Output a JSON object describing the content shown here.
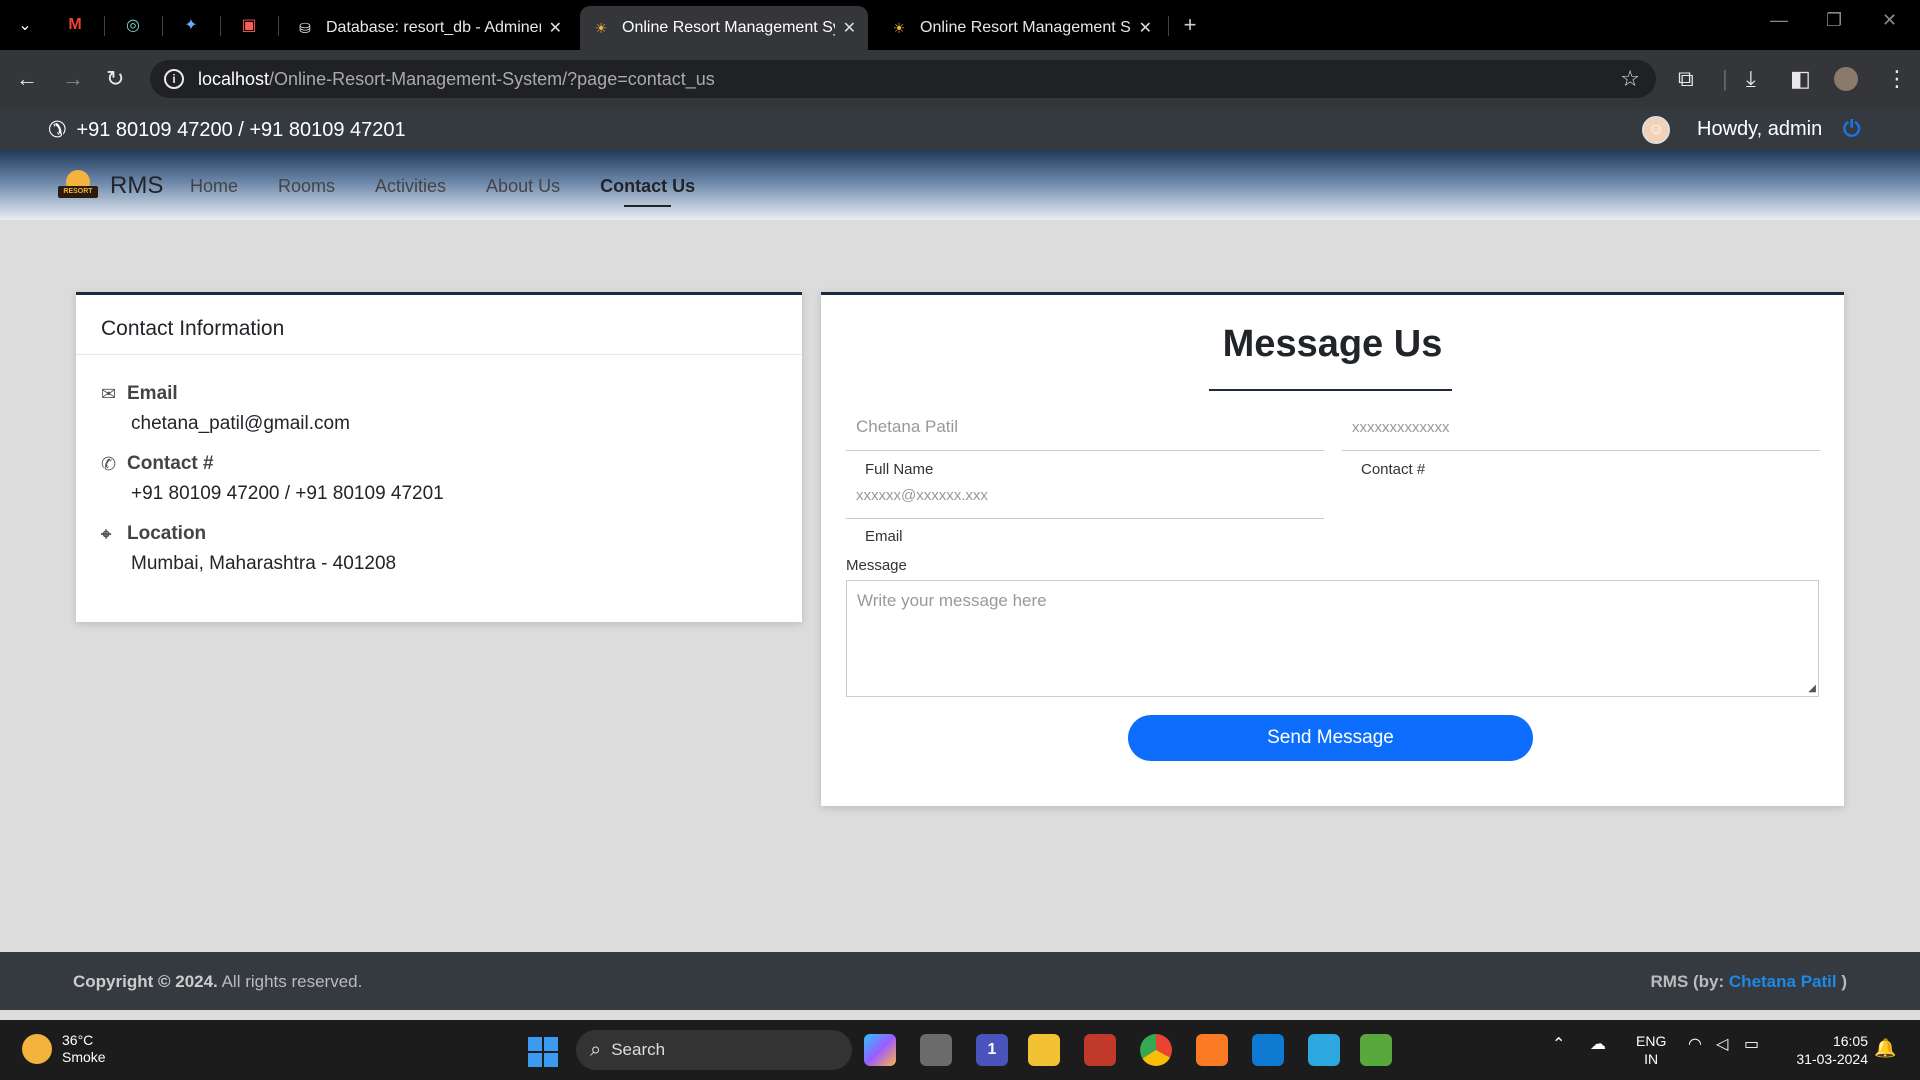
{
  "browser": {
    "tabs": [
      {
        "title": "Database: resort_db - Adminer",
        "active": false
      },
      {
        "title": "Online Resort Management Sys",
        "active": true
      },
      {
        "title": "Online Resort Management Sys",
        "active": false
      }
    ],
    "url_host": "localhost",
    "url_path": "/Online-Resort-Management-System/?page=contact_us"
  },
  "topbar": {
    "phone": "+91 80109 47200 / +91 80109 47201",
    "greeting": "Howdy, admin"
  },
  "nav": {
    "brand": "RMS",
    "logo_text": "RESORT",
    "links": [
      "Home",
      "Rooms",
      "Activities",
      "About Us",
      "Contact Us"
    ],
    "active": "Contact Us"
  },
  "contact": {
    "header": "Contact Information",
    "email_label": "Email",
    "email_value": "chetana_patil@gmail.com",
    "contact_label": "Contact #",
    "contact_value": "+91 80109 47200 / +91 80109 47201",
    "location_label": "Location",
    "location_value": "Mumbai, Maharashtra - 401208"
  },
  "message": {
    "title": "Message Us",
    "fullname_placeholder": "Chetana Patil",
    "fullname_label": "Full Name",
    "contact_placeholder": "xxxxxxxxxxxxx",
    "contact_label": "Contact #",
    "email_placeholder": "xxxxxx@xxxxxx.xxx",
    "email_label": "Email",
    "message_label": "Message",
    "message_placeholder": "Write your message here",
    "send_label": "Send Message"
  },
  "footer": {
    "copyright_bold": "Copyright © 2024.",
    "copyright_rest": " All rights reserved.",
    "credit_prefix": "RMS (by: ",
    "credit_author": "Chetana Patil",
    "credit_suffix": " )"
  },
  "taskbar": {
    "temperature": "36°C",
    "weather": "Smoke",
    "search": "Search",
    "lang1": "ENG",
    "lang2": "IN",
    "time": "16:05",
    "date": "31-03-2024",
    "teams_badge": "1"
  },
  "colors": {
    "accent": "#0d6efd",
    "dark": "#343a40",
    "card_border": "#1c2a3f"
  }
}
